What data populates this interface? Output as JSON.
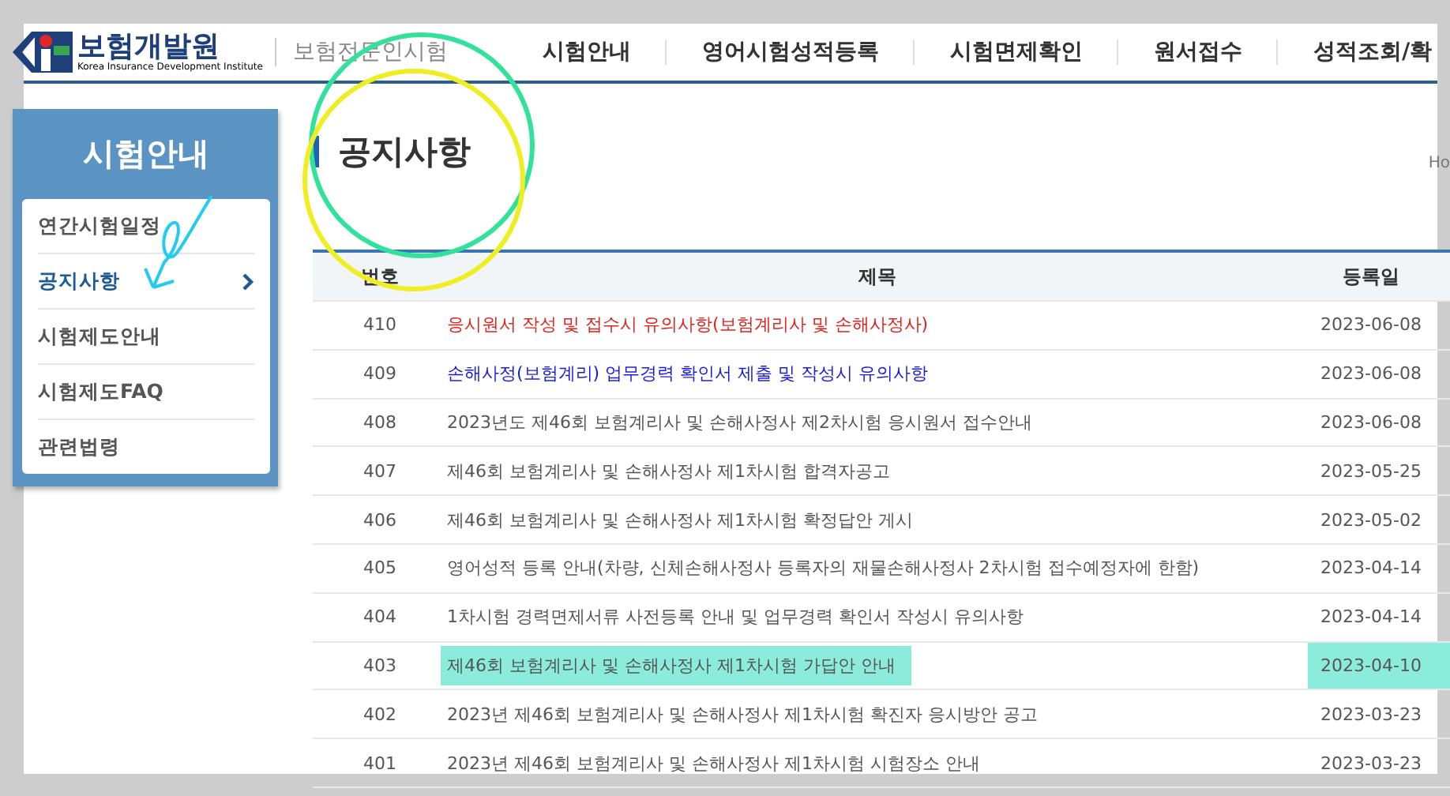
{
  "header": {
    "logo_text": "보험개발원",
    "logo_subtitle": "Korea Insurance Development Institute",
    "site_name": "보험전문인시험",
    "nav": [
      "시험안내",
      "영어시험성적등록",
      "시험면제확인",
      "원서접수",
      "성적조회/확"
    ]
  },
  "sidebar": {
    "title": "시험안내",
    "items": [
      {
        "label": "연간시험일정",
        "selected": false
      },
      {
        "label": "공지사항",
        "selected": true
      },
      {
        "label": "시험제도안내",
        "selected": false
      },
      {
        "label": "시험제도FAQ",
        "selected": false
      },
      {
        "label": "관련법령",
        "selected": false
      }
    ]
  },
  "page_title": "공지사항",
  "breadcrumb": "Ho",
  "table": {
    "columns": [
      "번호",
      "제목",
      "등록일"
    ],
    "rows": [
      {
        "number": "410",
        "title": "응시원서 작성 및 접수시 유의사항(보험계리사 및 손해사정사)",
        "date": "2023-06-08",
        "color": "#e0231c",
        "highlighted": false
      },
      {
        "number": "409",
        "title": "손해사정(보험계리) 업무경력 확인서 제출 및 작성시 유의사항",
        "date": "2023-06-08",
        "color": "#1a1adf",
        "highlighted": false
      },
      {
        "number": "408",
        "title": "2023년도 제46회 보험계리사 및 손해사정사 제2차시험 응시원서 접수안내",
        "date": "2023-06-08",
        "color": "#555555",
        "highlighted": false
      },
      {
        "number": "407",
        "title": "제46회 보험계리사 및 손해사정사 제1차시험 합격자공고",
        "date": "2023-05-25",
        "color": "#555555",
        "highlighted": false
      },
      {
        "number": "406",
        "title": "제46회 보험계리사 및 손해사정사 제1차시험 확정답안 게시",
        "date": "2023-05-02",
        "color": "#555555",
        "highlighted": false
      },
      {
        "number": "405",
        "title": "영어성적 등록 안내(차량, 신체손해사정사 등록자의 재물손해사정사 2차시험 접수예정자에 한함)",
        "date": "2023-04-14",
        "color": "#555555",
        "highlighted": false
      },
      {
        "number": "404",
        "title": "1차시험 경력면제서류 사전등록 안내 및 업무경력 확인서 작성시 유의사항",
        "date": "2023-04-14",
        "color": "#555555",
        "highlighted": false
      },
      {
        "number": "403",
        "title": "제46회 보험계리사 및 손해사정사 제1차시험 가답안 안내",
        "date": "2023-04-10",
        "color": "#555555",
        "highlighted": true
      },
      {
        "number": "402",
        "title": "2023년 제46회 보험계리사 및 손해사정사 제1차시험 확진자 응시방안 공고",
        "date": "2023-03-23",
        "color": "#555555",
        "highlighted": false
      },
      {
        "number": "401",
        "title": "2023년 제46회 보험계리사 및 손해사정사 제1차시험 시험장소 안내",
        "date": "2023-03-23",
        "color": "#555555",
        "highlighted": false
      }
    ]
  }
}
